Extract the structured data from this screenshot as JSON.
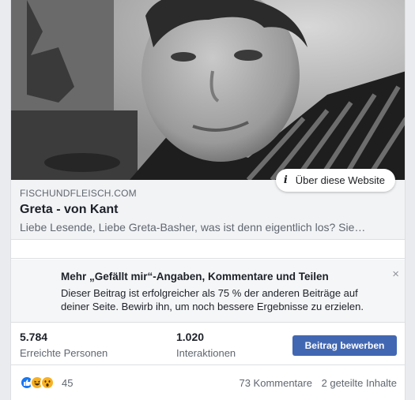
{
  "post": {
    "site_info_label": "Über diese Website",
    "link": {
      "domain": "FISCHUNDFLEISCH.COM",
      "title": "Greta - von Kant",
      "description": "Liebe Lesende, Liebe Greta-Basher, was ist denn eigentlich los? Sie…"
    }
  },
  "boost_banner": {
    "title": "Mehr „Gefällt mir“-Angaben, Kommentare und Teilen",
    "text": "Dieser Beitrag ist erfolgreicher als 75 % der anderen Beiträge auf deiner Seite. Bewirb ihn, um noch bessere Ergebnisse zu erzielen.",
    "close_symbol": "×"
  },
  "stats": {
    "reach_value": "5.784",
    "reach_label": "Erreichte Personen",
    "engagement_value": "1.020",
    "engagement_label": "Interaktionen",
    "boost_button": "Beitrag bewerben"
  },
  "reactions": {
    "icons": [
      "like-icon",
      "haha-icon",
      "wow-icon"
    ],
    "count": "45",
    "comments": "73 Kommentare",
    "shares": "2 geteilte Inhalte"
  },
  "colors": {
    "primary_button": "#4267b2",
    "like_blue": "#1877f2",
    "reaction_yellow": "#f7b125"
  }
}
